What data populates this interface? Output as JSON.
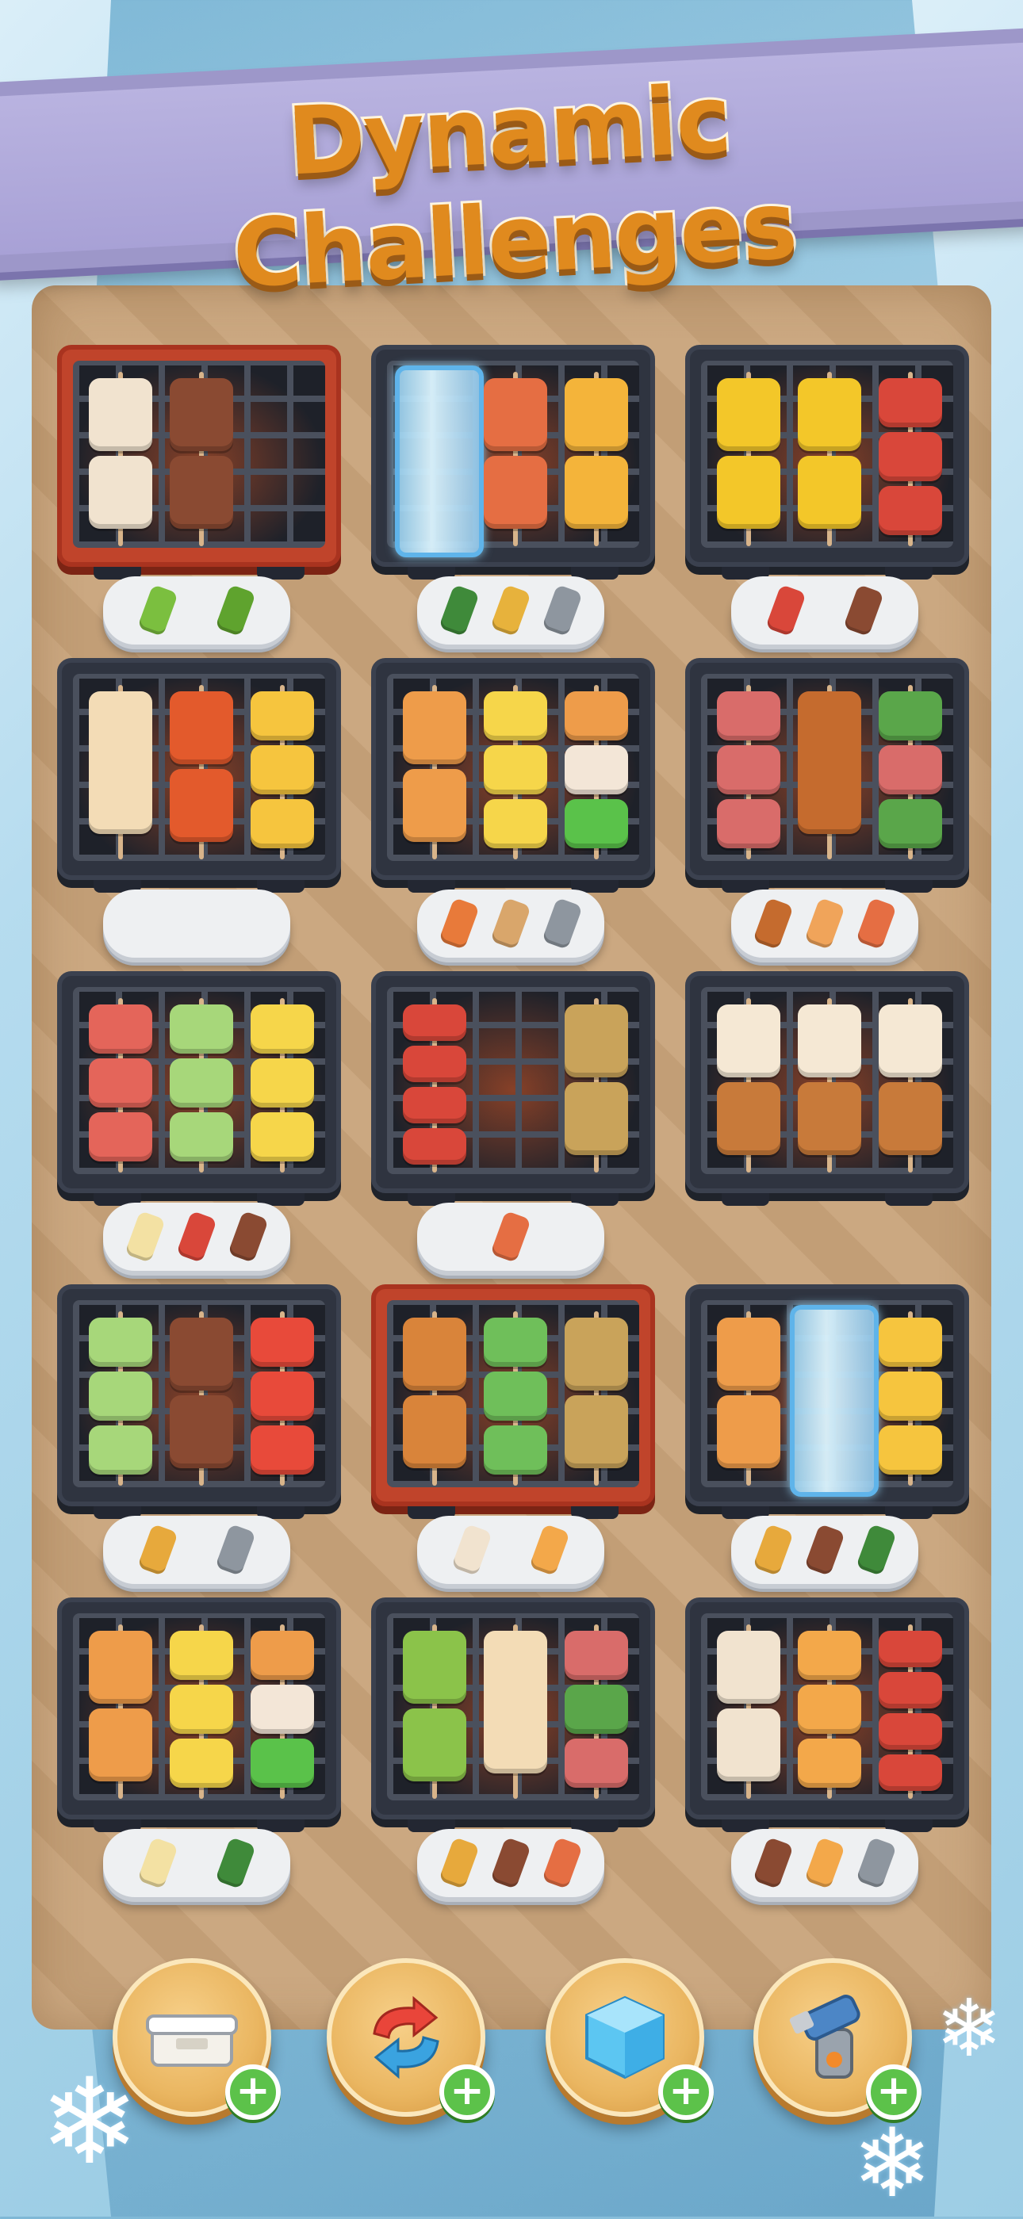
{
  "title": "Dynamic Challenges",
  "colors": {
    "title_text": "#e08a1e",
    "banner": "#a8a1d6",
    "grill": "#2f3440",
    "grill_hot": "#c0442b",
    "plus_badge": "#5cc24a"
  },
  "stations": [
    {
      "id": "r1c1",
      "grill": "hot",
      "skewers": [
        [
          "#f1e3cf",
          "#f1e3cf"
        ],
        [
          "#8a4a32",
          "#8a4a32"
        ]
      ],
      "plate": [
        "#7bbf3f",
        "#5fa32e"
      ]
    },
    {
      "id": "r1c2",
      "grill": "normal",
      "ice": true,
      "skewers": [
        [
          "#b8d8ea"
        ],
        [
          "#e56e43",
          "#e56e43"
        ],
        [
          "#f4b43a",
          "#f4b43a"
        ]
      ],
      "plate": [
        "#3f8a3a",
        "#e7b23c",
        "#8e969f"
      ]
    },
    {
      "id": "r1c3",
      "grill": "normal",
      "skewers": [
        [
          "#f3c729",
          "#f3c729"
        ],
        [
          "#f3c729",
          "#f3c729"
        ],
        [
          "#d9473a",
          "#d9473a",
          "#d9473a"
        ]
      ],
      "plate": [
        "#d9473a",
        "#8a4a32"
      ]
    },
    {
      "id": "r2c1",
      "grill": "normal",
      "skewers": [
        [
          "#f3dcb6"
        ],
        [
          "#e35a2c",
          "#e35a2c"
        ],
        [
          "#f6c53e",
          "#f6c53e",
          "#f6c53e"
        ]
      ],
      "plate": []
    },
    {
      "id": "r2c2",
      "grill": "normal",
      "skewers": [
        [
          "#ee9c4a",
          "#ee9c4a"
        ],
        [
          "#f6d64a",
          "#f6d64a",
          "#f6d64a"
        ],
        [
          "#ee9c4a",
          "#f3e6d7",
          "#5ac24a"
        ]
      ],
      "plate": [
        "#e87a3a",
        "#d9a66b",
        "#8e969f"
      ]
    },
    {
      "id": "r2c3",
      "grill": "normal",
      "skewers": [
        [
          "#d96c6a",
          "#d96c6a",
          "#d96c6a"
        ],
        [
          "#c56b2e"
        ],
        [
          "#5aa64a",
          "#d96c6a",
          "#5aa64a"
        ]
      ],
      "plate": [
        "#c56b2e",
        "#f0a45a",
        "#e56e43"
      ]
    },
    {
      "id": "r3c1",
      "grill": "normal",
      "skewers": [
        [
          "#e4655a",
          "#e4655a",
          "#e4655a"
        ],
        [
          "#a7d77a",
          "#a7d77a",
          "#a7d77a"
        ],
        [
          "#f6d64a",
          "#f6d64a",
          "#f6d64a"
        ]
      ],
      "plate": [
        "#f3e1a3",
        "#d9473a",
        "#8a4a32"
      ]
    },
    {
      "id": "r3c2",
      "grill": "normal",
      "skewers": [
        [
          "#d9473a",
          "#d9473a",
          "#d9473a",
          "#d9473a"
        ],
        [],
        [
          "#c9a35a",
          "#c9a35a"
        ]
      ],
      "plate": [
        "#e56e43"
      ]
    },
    {
      "id": "r3c3",
      "grill": "normal",
      "skewers": [
        [
          "#f5e8d4",
          "#c87a3a"
        ],
        [
          "#f5e8d4",
          "#c87a3a"
        ],
        [
          "#f5e8d4",
          "#c87a3a"
        ]
      ],
      "plate": null
    },
    {
      "id": "r4c1",
      "grill": "normal",
      "skewers": [
        [
          "#a7d77a",
          "#a7d77a",
          "#a7d77a"
        ],
        [
          "#8a4a32",
          "#8a4a32"
        ],
        [
          "#e84a3a",
          "#e84a3a",
          "#e84a3a"
        ]
      ],
      "plate": [
        "#e7a93c",
        "#8e969f"
      ]
    },
    {
      "id": "r4c2",
      "grill": "hot",
      "skewers": [
        [
          "#d9843a",
          "#d9843a"
        ],
        [
          "#6fbf5a",
          "#6fbf5a",
          "#6fbf5a"
        ],
        [
          "#c9a35a",
          "#c9a35a"
        ]
      ],
      "plate": [
        "#f1e3cf",
        "#f3a84a"
      ]
    },
    {
      "id": "r4c3",
      "grill": "normal",
      "ice": true,
      "skewers": [
        [
          "#ee9c4a",
          "#ee9c4a"
        ],
        [
          "#b8d8ea"
        ],
        [
          "#f6c53e",
          "#f6c53e",
          "#f6c53e"
        ]
      ],
      "plate": [
        "#e7a93c",
        "#8a4a32",
        "#3f8a3a"
      ]
    },
    {
      "id": "r5c1",
      "grill": "normal",
      "skewers": [
        [
          "#ee9c4a",
          "#ee9c4a"
        ],
        [
          "#f6d64a",
          "#f6d64a",
          "#f6d64a"
        ],
        [
          "#ee9c4a",
          "#f3e6d7",
          "#5ac24a"
        ]
      ],
      "plate": [
        "#f3e1a3",
        "#3f8a3a"
      ]
    },
    {
      "id": "r5c2",
      "grill": "normal",
      "skewers": [
        [
          "#8bc34a",
          "#8bc34a"
        ],
        [
          "#f3dcb6"
        ],
        [
          "#d96c6a",
          "#5aa64a",
          "#d96c6a"
        ]
      ],
      "plate": [
        "#e7a93c",
        "#8a4a32",
        "#e56e43"
      ]
    },
    {
      "id": "r5c3",
      "grill": "normal",
      "skewers": [
        [
          "#f1e3cf",
          "#f1e3cf"
        ],
        [
          "#f3a84a",
          "#f3a84a",
          "#f3a84a"
        ],
        [
          "#d9473a",
          "#d9473a",
          "#d9473a",
          "#d9473a"
        ]
      ],
      "plate": [
        "#8a4a32",
        "#f3a84a",
        "#8e969f"
      ]
    }
  ],
  "powerups": [
    {
      "name": "takeout-box",
      "icon": "box-icon"
    },
    {
      "name": "shuffle",
      "icon": "shuffle-icon"
    },
    {
      "name": "ice-cube",
      "icon": "ice-cube-icon"
    },
    {
      "name": "torch",
      "icon": "torch-icon"
    }
  ],
  "plus_label": "+"
}
